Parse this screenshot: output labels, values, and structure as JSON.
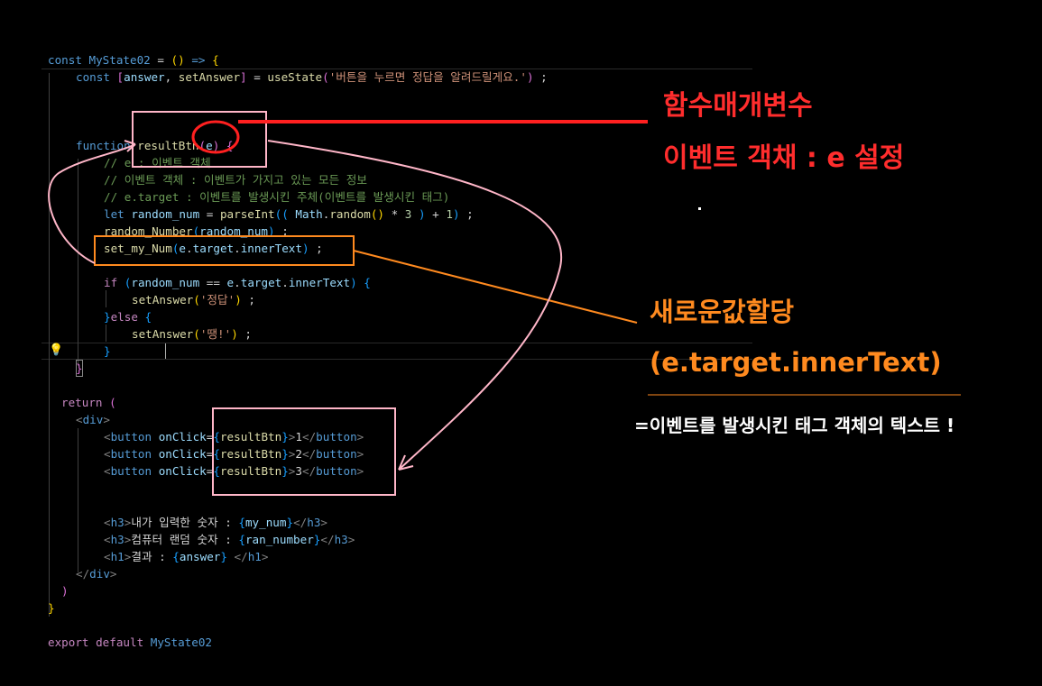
{
  "code": {
    "l1": [
      "const",
      "MyState02",
      "=",
      "()",
      "=>",
      "{"
    ],
    "l2": [
      "const",
      "[",
      "answer",
      ",",
      "setAnswer",
      "]",
      "=",
      "useState",
      "(",
      "'버튼을 누르면 정답을 알려드릴게요.'",
      ")",
      ";"
    ],
    "l3": [
      "function",
      "resultBtn",
      "(",
      "e",
      ")",
      "{"
    ],
    "l4": "// e : 이벤트 객체",
    "l5": "// 이벤트 객체 : 이벤트가 가지고 있는 모든 정보",
    "l6": "// e.target : 이벤트를 발생시킨 주체(이벤트를 발생시킨 태그)",
    "l7": [
      "let",
      "random_num",
      "=",
      "parseInt",
      "((",
      "Math",
      ".",
      "random",
      "()",
      "*",
      "3",
      ")",
      "+",
      "1",
      ")",
      ";"
    ],
    "l8": [
      "random_Number",
      "(",
      "random_num",
      ")",
      ";"
    ],
    "l9": [
      "set_my_Num",
      "(",
      "e",
      ".",
      "target",
      ".",
      "innerText",
      ")",
      ";"
    ],
    "l10": [
      "if",
      "(",
      "random_num",
      "==",
      "e",
      ".",
      "target",
      ".",
      "innerText",
      ")",
      "{"
    ],
    "l11": [
      "setAnswer",
      "(",
      "'정답'",
      ")",
      ";"
    ],
    "l12": [
      "}",
      "else",
      "{"
    ],
    "l13": [
      "setAnswer",
      "(",
      "'땡!'",
      ")",
      ";"
    ],
    "l14": "}",
    "l15": "}",
    "l16": [
      "return",
      "("
    ],
    "l17": [
      "<",
      "div",
      ">"
    ],
    "buttons": [
      [
        "<",
        "button",
        "onClick",
        "=",
        "{",
        "resultBtn",
        "}",
        ">",
        "1",
        "</",
        "button",
        ">"
      ],
      [
        "<",
        "button",
        "onClick",
        "=",
        "{",
        "resultBtn",
        "}",
        ">",
        "2",
        "</",
        "button",
        ">"
      ],
      [
        "<",
        "button",
        "onClick",
        "=",
        "{",
        "resultBtn",
        "}",
        ">",
        "3",
        "</",
        "button",
        ">"
      ]
    ],
    "l21": [
      "<",
      "h3",
      ">",
      "내가 입력한 숫자 : ",
      "{",
      "my_num",
      "}",
      "</",
      "h3",
      ">"
    ],
    "l22": [
      "<",
      "h3",
      ">",
      "컴퓨터 랜덤 숫자 : ",
      "{",
      "ran_number",
      "}",
      "</",
      "h3",
      ">"
    ],
    "l23": [
      "<",
      "h1",
      ">",
      "결과 : ",
      "{",
      "answer",
      "}",
      " </",
      "h1",
      ">"
    ],
    "l24": [
      "</",
      "div",
      ">"
    ],
    "l25": ")",
    "l26": "}",
    "l27": [
      "export",
      "default",
      "MyState02"
    ]
  },
  "annotations": {
    "red_title": "함수매개변수",
    "red_subtitle": "이벤트 객채 : e 설정",
    "orange_title": "새로운값할당",
    "orange_subtitle": "(e.target.innerText)",
    "white_note": "=이벤트를 발생시킨 태그 객체의 텍스트 !"
  },
  "colors": {
    "background": "#000000",
    "keyword": "#569cd6",
    "control": "#c586c0",
    "function": "#dcdcaa",
    "variable": "#9cdcfe",
    "string": "#ce9178",
    "comment": "#6a9955",
    "number": "#b5cea8",
    "annotation_red": "#ff2d2d",
    "annotation_orange": "#ff8a1f",
    "annotation_pink": "#ffb6c8"
  },
  "icons": {
    "lightbulb": "lightbulb-icon"
  }
}
